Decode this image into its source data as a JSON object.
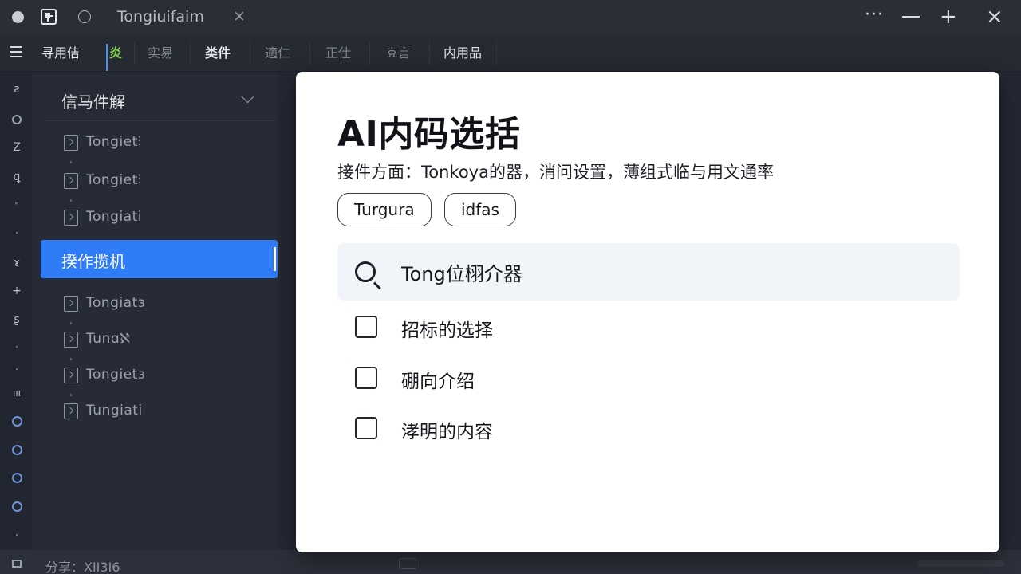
{
  "window": {
    "tab_title": "Tongiuifaim",
    "tab_close": "×",
    "more": "···",
    "maximize": "+",
    "close": "×"
  },
  "menubar": {
    "items": [
      {
        "label": "寻用佶",
        "muted": false
      },
      {
        "label": "炎",
        "muted": false,
        "accent": "#7fd14a"
      },
      {
        "label": "实易",
        "muted": true
      },
      {
        "label": "类件",
        "muted": false
      },
      {
        "label": "適仁",
        "muted": true
      },
      {
        "label": "正仕",
        "muted": true
      },
      {
        "label": "효言",
        "muted": true
      },
      {
        "label": "内用品",
        "muted": false
      }
    ]
  },
  "rail": {
    "glyphs": [
      "ƨ",
      "Z",
      "ꝗ",
      "ꙵ",
      "ɤ",
      "+",
      "ʂ",
      "ııı"
    ]
  },
  "explorer": {
    "header": "信马件解",
    "files_top": [
      "Tongiet⫶",
      "Tongiet⫶",
      "Tongiati"
    ],
    "active_file": "揆作揽机",
    "files_bottom": [
      "Tongiatɜ",
      "Tunɑℵ",
      "Tongietɜ",
      "Tungiati"
    ]
  },
  "statusbar": {
    "text": "分享：XII3I6"
  },
  "dialog": {
    "title": "AI内码选括",
    "subtitle": "接件方面：Tonkoya的器，消问设置，薄组式临与用文通率",
    "chips": [
      "Turgura",
      "idfas"
    ],
    "search_value": "Tong位栩介器",
    "options": [
      {
        "label": "招标的选择",
        "checked": false
      },
      {
        "label": "硼向介绍",
        "checked": false
      },
      {
        "label": "涍明的内容",
        "checked": false
      }
    ]
  },
  "colors": {
    "accent": "#2f7cf6",
    "rail_ring": "#6f93d6",
    "dialog_bg": "#ffffff",
    "search_bg": "#f1f4f9"
  }
}
